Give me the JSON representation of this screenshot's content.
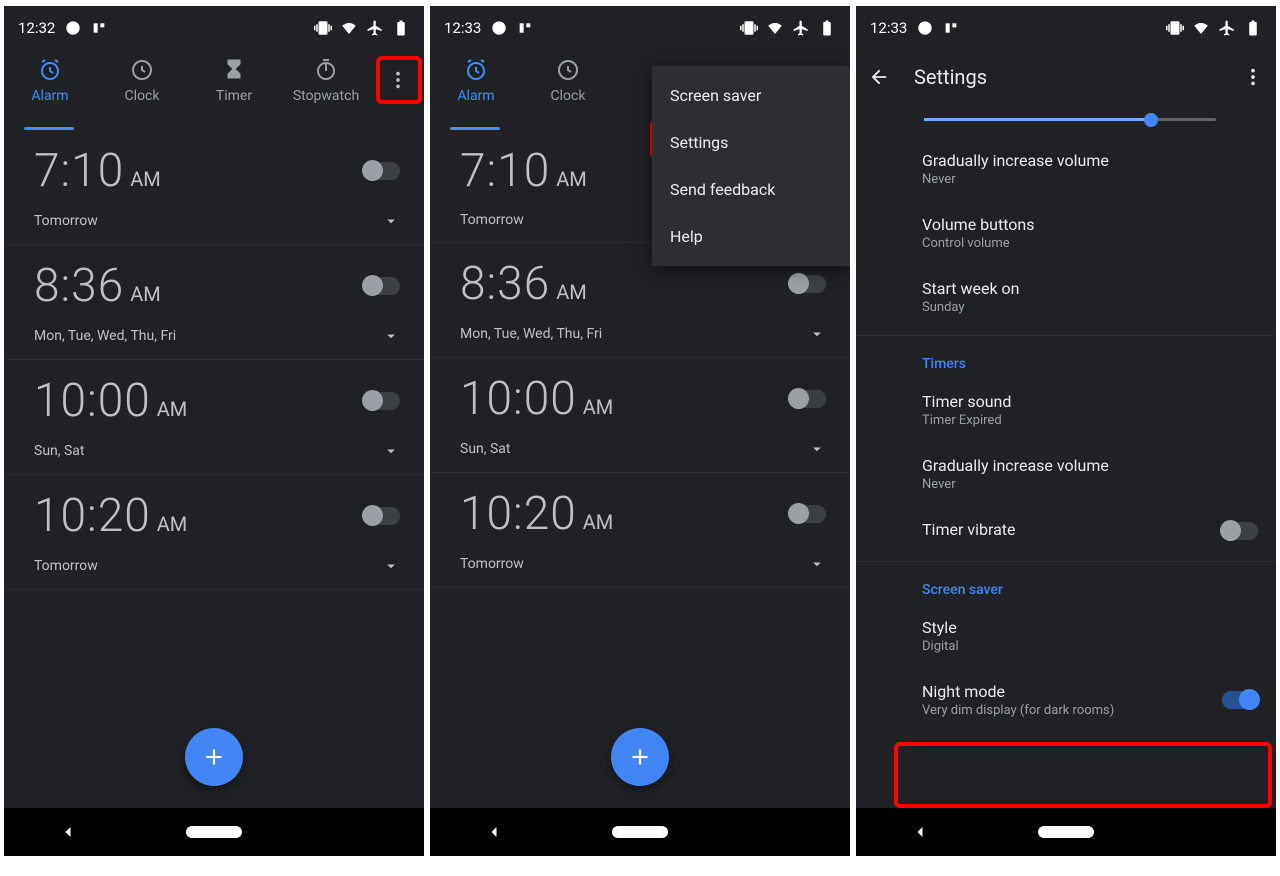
{
  "status": {
    "time1": "12:32",
    "time2": "12:33",
    "time3": "12:33"
  },
  "tabs": [
    "Alarm",
    "Clock",
    "Timer",
    "Stopwatch"
  ],
  "alarms": [
    {
      "time": "7:10",
      "ampm": "AM",
      "sub": "Tomorrow"
    },
    {
      "time": "8:36",
      "ampm": "AM",
      "sub": "Mon, Tue, Wed, Thu, Fri"
    },
    {
      "time": "10:00",
      "ampm": "AM",
      "sub": "Sun, Sat"
    },
    {
      "time": "10:20",
      "ampm": "AM",
      "sub": "Tomorrow"
    }
  ],
  "menu": [
    "Screen saver",
    "Settings",
    "Send feedback",
    "Help"
  ],
  "settings": {
    "title": "Settings",
    "items": [
      {
        "t": "Gradually increase volume",
        "s": "Never"
      },
      {
        "t": "Volume buttons",
        "s": "Control volume"
      },
      {
        "t": "Start week on",
        "s": "Sunday"
      }
    ],
    "timers_header": "Timers",
    "timers": [
      {
        "t": "Timer sound",
        "s": "Timer Expired"
      },
      {
        "t": "Gradually increase volume",
        "s": "Never"
      },
      {
        "t": "Timer vibrate",
        "s": ""
      }
    ],
    "ss_header": "Screen saver",
    "ss": [
      {
        "t": "Style",
        "s": "Digital"
      },
      {
        "t": "Night mode",
        "s": "Very dim display (for dark rooms)"
      }
    ]
  }
}
